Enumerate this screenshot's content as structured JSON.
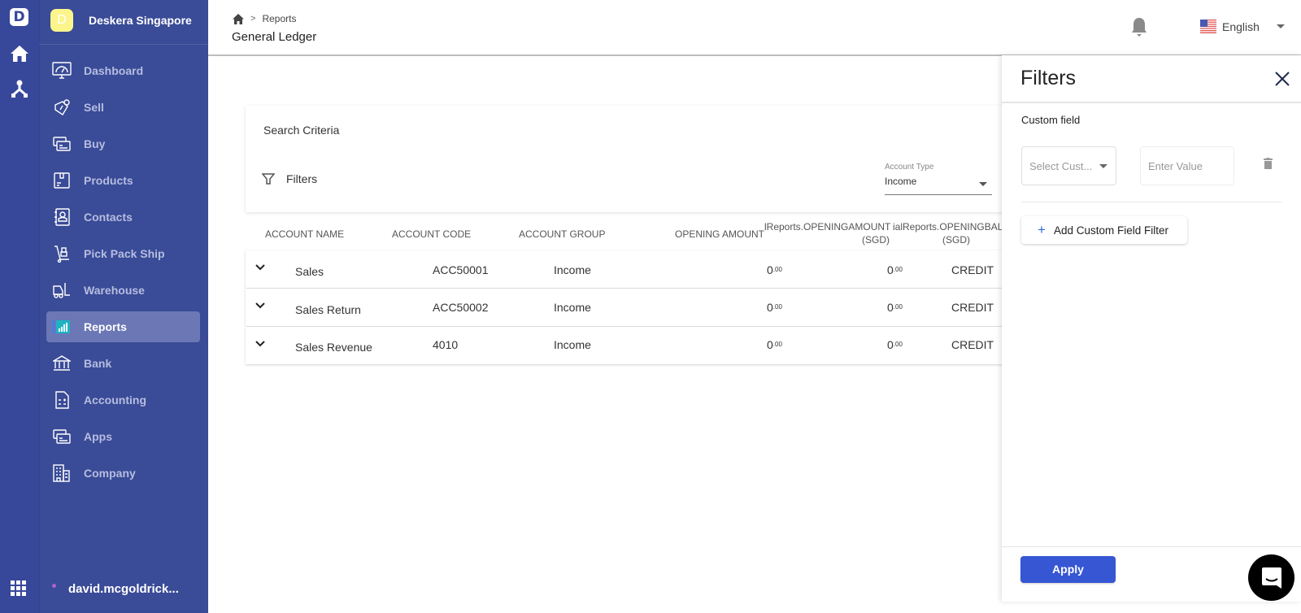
{
  "rail": {
    "logo_letter": "D",
    "icons": [
      "home-icon",
      "org-tree-icon",
      "apps-grid-icon"
    ]
  },
  "sidebar": {
    "org_avatar_letter": "D",
    "org_name": "Deskera Singapore",
    "items": [
      {
        "label": "Dashboard",
        "icon": "dashboard-icon",
        "active": false
      },
      {
        "label": "Sell",
        "icon": "price-tag-icon",
        "active": false
      },
      {
        "label": "Buy",
        "icon": "cards-icon",
        "active": false
      },
      {
        "label": "Products",
        "icon": "box-icon",
        "active": false
      },
      {
        "label": "Contacts",
        "icon": "contact-book-icon",
        "active": false
      },
      {
        "label": "Pick Pack Ship",
        "icon": "hand-truck-icon",
        "active": false
      },
      {
        "label": "Warehouse",
        "icon": "forklift-icon",
        "active": false
      },
      {
        "label": "Reports",
        "icon": "bar-chart-icon",
        "active": true
      },
      {
        "label": "Bank",
        "icon": "bank-icon",
        "active": false
      },
      {
        "label": "Accounting",
        "icon": "calculator-icon",
        "active": false
      },
      {
        "label": "Apps",
        "icon": "cards-icon",
        "active": false
      },
      {
        "label": "Company",
        "icon": "building-icon",
        "active": false
      }
    ],
    "user_name": "david.mcgoldrick..."
  },
  "header": {
    "breadcrumb": [
      "Reports"
    ],
    "page_title": "General Ledger",
    "language": "English"
  },
  "search": {
    "title": "Search Criteria",
    "filters_label": "Filters",
    "account_type_label": "Account Type",
    "account_type_value": "Income"
  },
  "table": {
    "columns": [
      "ACCOUNT NAME",
      "ACCOUNT CODE",
      "ACCOUNT GROUP",
      "OPENING AMOUNT",
      "lReports.OPENINGAMOUNT",
      "(SGD)",
      "ialReports.OPENINGBALA",
      "(SGD)"
    ],
    "rows": [
      {
        "name": "Sales",
        "code": "ACC50001",
        "group": "Income",
        "opening_int": "0",
        "opening_dec": ".00",
        "opening_sgd_int": "0",
        "opening_sgd_dec": ".00",
        "type": "CREDIT"
      },
      {
        "name": "Sales Return",
        "code": "ACC50002",
        "group": "Income",
        "opening_int": "0",
        "opening_dec": ".00",
        "opening_sgd_int": "0",
        "opening_sgd_dec": ".00",
        "type": "CREDIT"
      },
      {
        "name": "Sales Revenue",
        "code": "4010",
        "group": "Income",
        "opening_int": "0",
        "opening_dec": ".00",
        "opening_sgd_int": "0",
        "opening_sgd_dec": ".00",
        "type": "CREDIT"
      }
    ]
  },
  "filter_panel": {
    "title": "Filters",
    "section_label": "Custom field",
    "select_placeholder": "Select Cust...",
    "value_placeholder": "Enter Value",
    "add_button": "Add Custom Field Filter",
    "apply_button": "Apply"
  },
  "colors": {
    "sidebar_bg": "#3a4b97",
    "rail_bg": "#37489a",
    "active_item": "#6b78b5",
    "primary_button": "#3656d4",
    "avatar": "#fcf58c"
  }
}
